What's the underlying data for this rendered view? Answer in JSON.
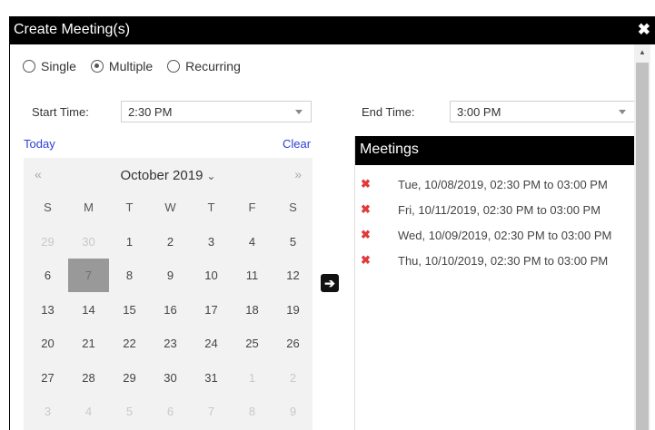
{
  "dialog": {
    "title": "Create Meeting(s)",
    "close_glyph": "✖"
  },
  "mode": {
    "options": [
      {
        "label": "Single",
        "checked": false
      },
      {
        "label": "Multiple",
        "checked": true
      },
      {
        "label": "Recurring",
        "checked": false
      }
    ]
  },
  "start_time": {
    "label": "Start Time:",
    "value": "2:30 PM"
  },
  "end_time": {
    "label": "End Time:",
    "value": "3:00 PM"
  },
  "links": {
    "today": "Today",
    "clear": "Clear"
  },
  "calendar": {
    "prev": "«",
    "next": "»",
    "month_label": "October 2019",
    "month_chevron": "⌄",
    "weekdays": [
      "S",
      "M",
      "T",
      "W",
      "T",
      "F",
      "S"
    ],
    "weeks": [
      [
        {
          "d": "29",
          "other": true
        },
        {
          "d": "30",
          "other": true
        },
        {
          "d": "1"
        },
        {
          "d": "2"
        },
        {
          "d": "3"
        },
        {
          "d": "4"
        },
        {
          "d": "5"
        }
      ],
      [
        {
          "d": "6"
        },
        {
          "d": "7",
          "selected": true
        },
        {
          "d": "8"
        },
        {
          "d": "9"
        },
        {
          "d": "10"
        },
        {
          "d": "11"
        },
        {
          "d": "12"
        }
      ],
      [
        {
          "d": "13"
        },
        {
          "d": "14"
        },
        {
          "d": "15"
        },
        {
          "d": "16"
        },
        {
          "d": "17"
        },
        {
          "d": "18"
        },
        {
          "d": "19"
        }
      ],
      [
        {
          "d": "20"
        },
        {
          "d": "21"
        },
        {
          "d": "22"
        },
        {
          "d": "23"
        },
        {
          "d": "24"
        },
        {
          "d": "25"
        },
        {
          "d": "26"
        }
      ],
      [
        {
          "d": "27"
        },
        {
          "d": "28"
        },
        {
          "d": "29"
        },
        {
          "d": "30"
        },
        {
          "d": "31"
        },
        {
          "d": "1",
          "other": true
        },
        {
          "d": "2",
          "other": true
        }
      ],
      [
        {
          "d": "3",
          "other": true
        },
        {
          "d": "4",
          "other": true
        },
        {
          "d": "5",
          "other": true
        },
        {
          "d": "6",
          "other": true
        },
        {
          "d": "7",
          "other": true
        },
        {
          "d": "8",
          "other": true
        },
        {
          "d": "9",
          "other": true
        }
      ]
    ]
  },
  "transfer_glyph": "➔",
  "meetings": {
    "title": "Meetings",
    "remove_glyph": "✖",
    "items": [
      "Tue, 10/08/2019, 02:30 PM to 03:00 PM",
      "Fri, 10/11/2019, 02:30 PM to 03:00 PM",
      "Wed, 10/09/2019, 02:30 PM to 03:00 PM",
      "Thu, 10/10/2019, 02:30 PM to 03:00 PM"
    ]
  },
  "colors": {
    "titlebar": "#000000",
    "remove_icon": "#e03a3a",
    "link": "#2b3fd6",
    "selected_day": "#999999"
  }
}
